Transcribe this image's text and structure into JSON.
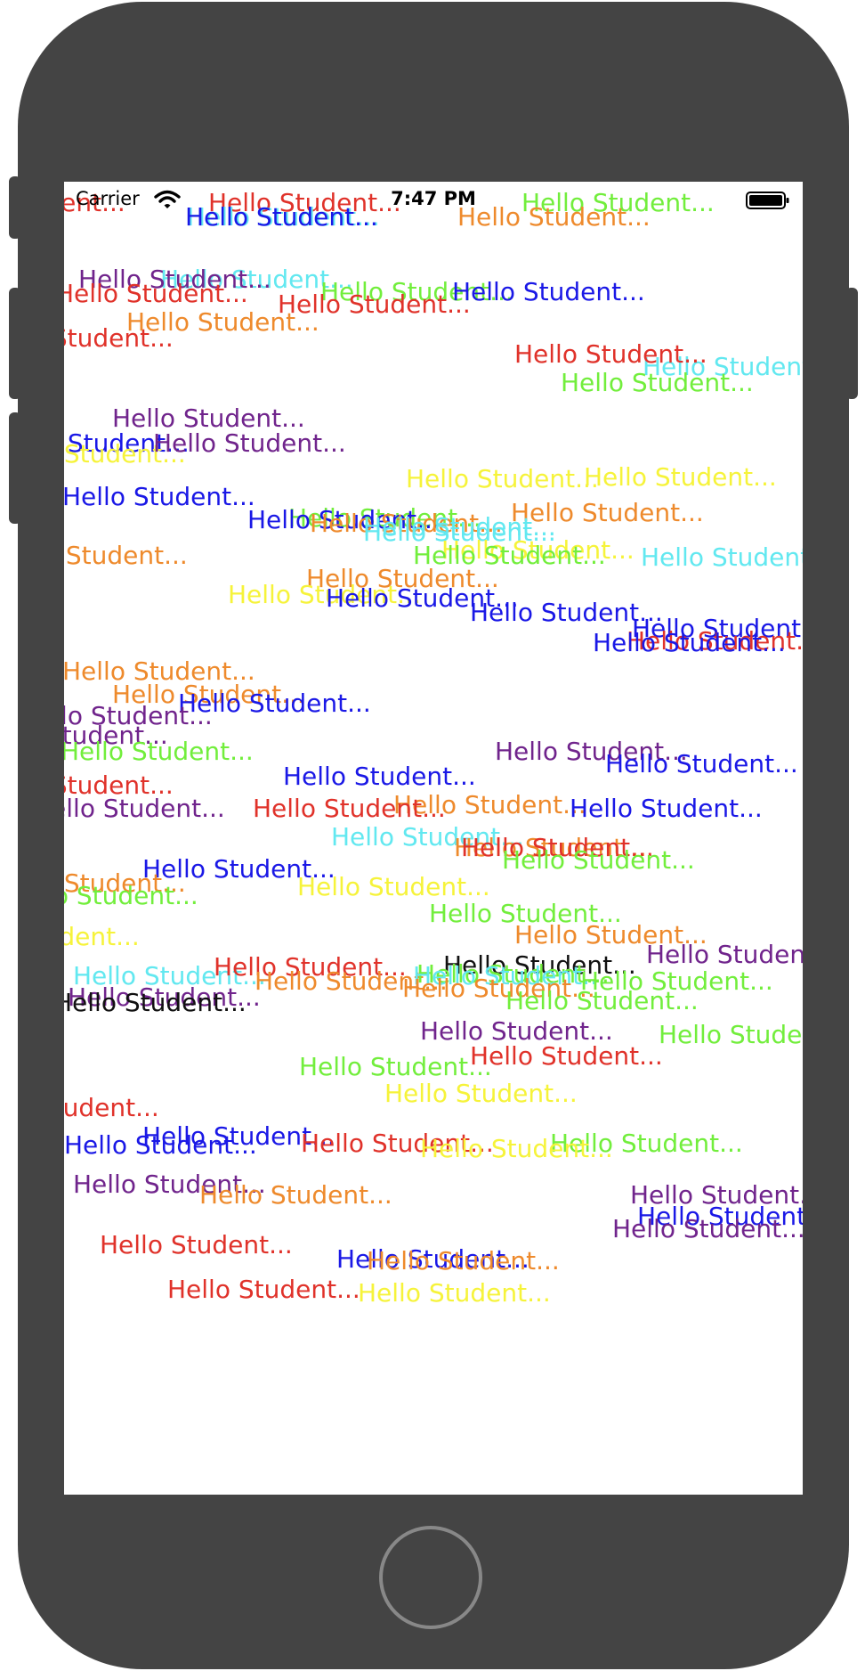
{
  "status_bar": {
    "carrier": "Carrier",
    "time": "7:47 PM",
    "wifi_icon": "wifi-icon",
    "battery_icon": "battery-full-icon"
  },
  "label_text": "Hello Student...",
  "colors": {
    "device_frame": "#444444",
    "screen_background": "#ffffff",
    "red": "#e0322a",
    "green": "#72ee3c",
    "blue": "#1a18e6",
    "orange": "#ee8a2c",
    "purple": "#70248c",
    "cyan": "#62e8f0",
    "yellow": "#f6f33a",
    "black": "#111111"
  },
  "labels": [
    {
      "text": "Hello Student...",
      "color": "red"
    },
    {
      "text": "Hello Student...",
      "color": "red"
    },
    {
      "text": "Hello Student...",
      "color": "cyan"
    },
    {
      "text": "Hello Student...",
      "color": "blue"
    },
    {
      "text": "Hello Student...",
      "color": "green"
    },
    {
      "text": "Hello Student...",
      "color": "orange"
    },
    {
      "text": "Hello Student...",
      "color": "cyan"
    },
    {
      "text": "Hello Student...",
      "color": "purple"
    },
    {
      "text": "Hello Student...",
      "color": "green"
    },
    {
      "text": "Hello Student...",
      "color": "blue"
    },
    {
      "text": "Hello Student...",
      "color": "red"
    },
    {
      "text": "Hello Student...",
      "color": "red"
    },
    {
      "text": "Hello Student...",
      "color": "orange"
    },
    {
      "text": "Hello Student...",
      "color": "red"
    },
    {
      "text": "Hello Student...",
      "color": "cyan"
    },
    {
      "text": "Hello Student...",
      "color": "green"
    },
    {
      "text": "Hello Student...",
      "color": "red"
    },
    {
      "text": "Hello Student...",
      "color": "purple"
    },
    {
      "text": "Hello Student...",
      "color": "blue"
    },
    {
      "text": "Hello Student...",
      "color": "yellow"
    },
    {
      "text": "Hello Student...",
      "color": "purple"
    },
    {
      "text": "Hello Student...",
      "color": "yellow"
    },
    {
      "text": "Hello Student...",
      "color": "yellow"
    },
    {
      "text": "Hello Student...",
      "color": "blue"
    },
    {
      "text": "Hello Student...",
      "color": "orange"
    },
    {
      "text": "Hello Student...",
      "color": "green"
    },
    {
      "text": "Hello Student...",
      "color": "blue"
    },
    {
      "text": "Hello Student...",
      "color": "orange"
    },
    {
      "text": "Hello Student...",
      "color": "cyan"
    },
    {
      "text": "Hello Student...",
      "color": "cyan"
    },
    {
      "text": "Hello Student...",
      "color": "orange"
    },
    {
      "text": "Hello Student...",
      "color": "yellow"
    },
    {
      "text": "Hello Student...",
      "color": "green"
    },
    {
      "text": "Hello Student...",
      "color": "cyan"
    },
    {
      "text": "Hello Student...",
      "color": "orange"
    },
    {
      "text": "Hello Student...",
      "color": "yellow"
    },
    {
      "text": "Hello Student...",
      "color": "blue"
    },
    {
      "text": "Hello Student...",
      "color": "blue"
    },
    {
      "text": "Hello Student...",
      "color": "blue"
    },
    {
      "text": "Hello Student...",
      "color": "red"
    },
    {
      "text": "Hello Student...",
      "color": "blue"
    },
    {
      "text": "Hello Student...",
      "color": "orange"
    },
    {
      "text": "Hello Student...",
      "color": "orange"
    },
    {
      "text": "Hello Student...",
      "color": "blue"
    },
    {
      "text": "Hello Student...",
      "color": "purple"
    },
    {
      "text": "Hello Student...",
      "color": "purple"
    },
    {
      "text": "Hello Student...",
      "color": "green"
    },
    {
      "text": "Hello Student...",
      "color": "purple"
    },
    {
      "text": "Hello Student...",
      "color": "blue"
    },
    {
      "text": "Hello Student...",
      "color": "blue"
    },
    {
      "text": "Hello Student...",
      "color": "red"
    },
    {
      "text": "Hello Student...",
      "color": "orange"
    },
    {
      "text": "Hello Student...",
      "color": "purple"
    },
    {
      "text": "Hello Student...",
      "color": "red"
    },
    {
      "text": "Hello Student...",
      "color": "blue"
    },
    {
      "text": "Hello Student...",
      "color": "cyan"
    },
    {
      "text": "Hello Student...",
      "color": "orange"
    },
    {
      "text": "Hello Student...",
      "color": "red"
    },
    {
      "text": "Hello Student...",
      "color": "green"
    },
    {
      "text": "Hello Student...",
      "color": "blue"
    },
    {
      "text": "Hello Student...",
      "color": "orange"
    },
    {
      "text": "Hello Student...",
      "color": "yellow"
    },
    {
      "text": "Hello Student...",
      "color": "green"
    },
    {
      "text": "Hello Student...",
      "color": "green"
    },
    {
      "text": "Hello Student...",
      "color": "yellow"
    },
    {
      "text": "Hello Student...",
      "color": "orange"
    },
    {
      "text": "Hello Student...",
      "color": "purple"
    },
    {
      "text": "Hello Student...",
      "color": "cyan"
    },
    {
      "text": "Hello Student...",
      "color": "red"
    },
    {
      "text": "Hello Student...",
      "color": "orange"
    },
    {
      "text": "Hello Student...",
      "color": "black"
    },
    {
      "text": "Hello Student...",
      "color": "green"
    },
    {
      "text": "Hello Student...",
      "color": "cyan"
    },
    {
      "text": "Hello Student...",
      "color": "orange"
    },
    {
      "text": "Hello Student...",
      "color": "green"
    },
    {
      "text": "Hello Student...",
      "color": "purple"
    },
    {
      "text": "Hello Student...",
      "color": "black"
    },
    {
      "text": "Hello Student...",
      "color": "green"
    },
    {
      "text": "Hello Student...",
      "color": "purple"
    },
    {
      "text": "Hello Student...",
      "color": "red"
    },
    {
      "text": "Hello Student...",
      "color": "green"
    },
    {
      "text": "Hello Student...",
      "color": "green"
    },
    {
      "text": "Hello Student...",
      "color": "red"
    },
    {
      "text": "Hello Student...",
      "color": "yellow"
    },
    {
      "text": "Hello Student...",
      "color": "blue"
    },
    {
      "text": "Hello Student...",
      "color": "red"
    },
    {
      "text": "Hello Student...",
      "color": "green"
    },
    {
      "text": "Hello Student...",
      "color": "yellow"
    },
    {
      "text": "Hello Student...",
      "color": "blue"
    },
    {
      "text": "Hello Student...",
      "color": "purple"
    },
    {
      "text": "Hello Student...",
      "color": "orange"
    },
    {
      "text": "Hello Student...",
      "color": "purple"
    },
    {
      "text": "Hello Student...",
      "color": "blue"
    },
    {
      "text": "Hello Student...",
      "color": "purple"
    },
    {
      "text": "Hello Student...",
      "color": "red"
    },
    {
      "text": "Hello Student...",
      "color": "blue"
    },
    {
      "text": "Hello Student...",
      "color": "orange"
    },
    {
      "text": "Hello Student...",
      "color": "red"
    },
    {
      "text": "Hello Student...",
      "color": "yellow"
    }
  ]
}
